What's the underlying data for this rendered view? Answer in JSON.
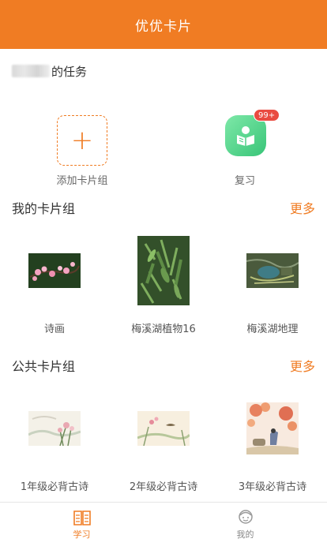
{
  "header": {
    "title": "优优卡片"
  },
  "task": {
    "suffix": "的任务"
  },
  "quick": {
    "add_label": "添加卡片组",
    "review_label": "复习",
    "review_badge": "99+"
  },
  "my_decks": {
    "title": "我的卡片组",
    "more": "更多",
    "items": [
      {
        "label": "诗画",
        "image": "pink-blossom-photo"
      },
      {
        "label": "梅溪湖植物16",
        "image": "green-plant-photo"
      },
      {
        "label": "梅溪湖地理",
        "image": "aerial-map-photo"
      }
    ]
  },
  "public_decks": {
    "title": "公共卡片组",
    "more": "更多",
    "items": [
      {
        "label": "1年级必背古诗",
        "image": "ink-painting-flowers"
      },
      {
        "label": "2年级必背古诗",
        "image": "ink-painting-birds"
      },
      {
        "label": "3年级必背古诗",
        "image": "autumn-maple-painting"
      }
    ]
  },
  "tabbar": {
    "tabs": [
      {
        "label": "学习",
        "icon": "book-icon",
        "active": true
      },
      {
        "label": "我的",
        "icon": "profile-icon",
        "active": false
      }
    ]
  },
  "colors": {
    "accent": "#f07c23",
    "badge": "#e94b40",
    "review_green": "#4ccf86"
  }
}
